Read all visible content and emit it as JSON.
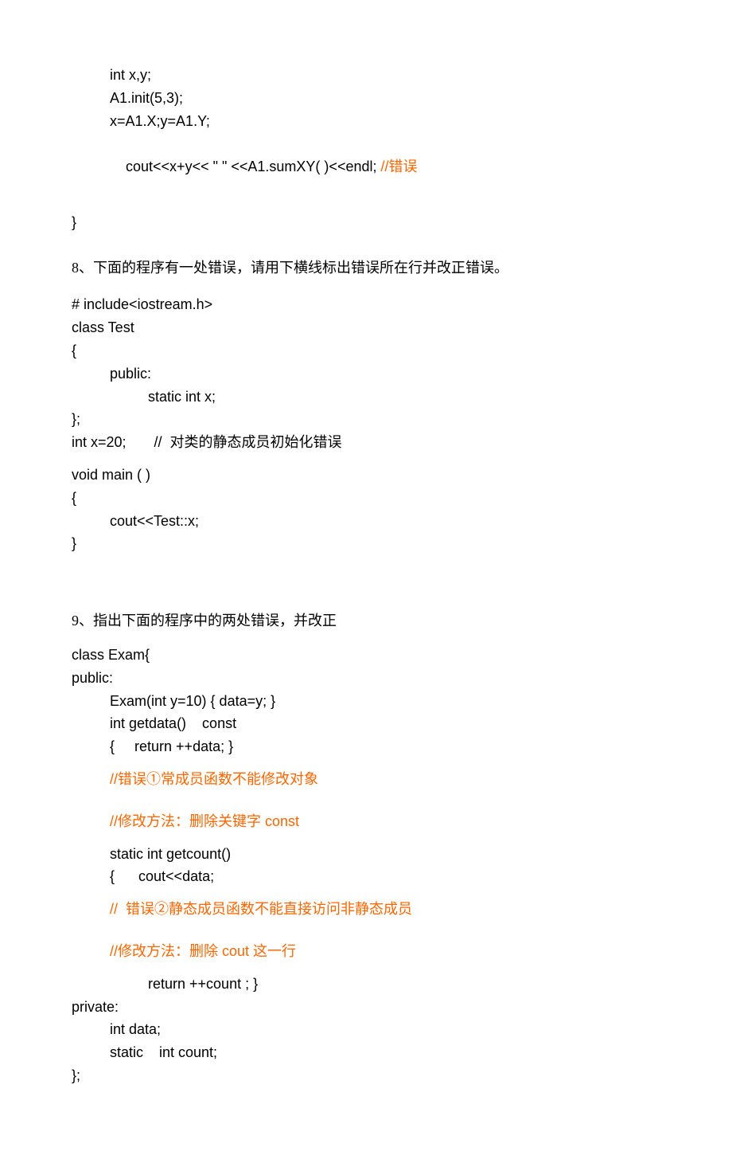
{
  "block7": {
    "l1": "int x,y;",
    "l2": "A1.init(5,3);",
    "l3": "x=A1.X;y=A1.Y;",
    "l4a": "cout<<x+y<< \" \" <<A1.sumXY( )<<endl; ",
    "l4b": "//错误",
    "close": "}"
  },
  "q8": {
    "title": "8、下面的程序有一处错误，请用下横线标出错误所在行并改正错误。",
    "l1": "# include<iostream.h>",
    "l2": "class Test",
    "l3": "{",
    "l4": "public:",
    "l5": "static int x;",
    "l6": "};",
    "l7": "int x=20;       //  对类的静态成员初始化错误",
    "l8": "void main ( )",
    "l9": "{",
    "l10": "cout<<Test::x;",
    "l11": "}"
  },
  "q9": {
    "title": "9、指出下面的程序中的两处错误，并改正",
    "l1": "class Exam{",
    "l2": "public:",
    "l3": "Exam(int y=10) { data=y; }",
    "l4": "int getdata()    const",
    "l5": "{     return ++data; }",
    "err1": "//错误①常成员函数不能修改对象",
    "fix1": "//修改方法：删除关键字 const",
    "l6": "static int getcount()",
    "l7": "{      cout<<data;",
    "err2": "//  错误②静态成员函数不能直接访问非静态成员",
    "fix2": "//修改方法：删除 cout 这一行",
    "l8": "return ++count ; }",
    "l9": "private:",
    "l10": "int data;",
    "l11": "static    int count;",
    "l12": "};"
  }
}
